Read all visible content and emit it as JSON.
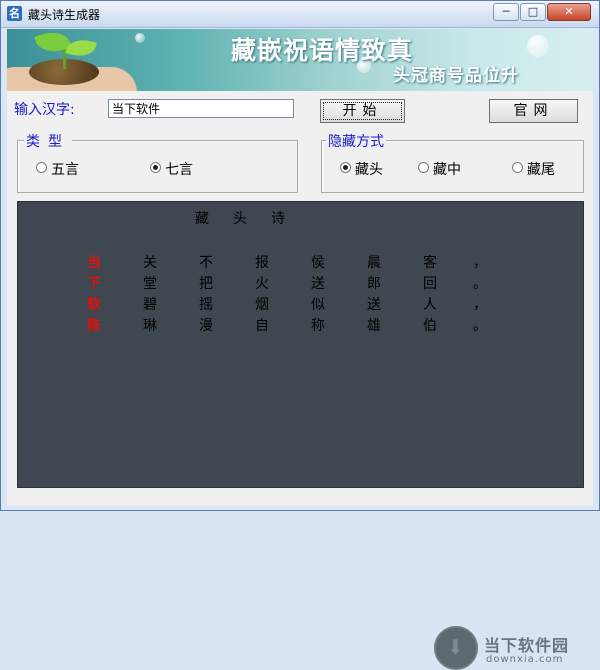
{
  "window": {
    "title": "藏头诗生成器",
    "app_icon_glyph": "名",
    "minimize_glyph": "─",
    "maximize_glyph": "□",
    "close_glyph": "✕"
  },
  "banner": {
    "main": "藏嵌祝语情致真",
    "sub": "头冠商号品位升"
  },
  "input": {
    "label": "输入汉字:",
    "value": "当下软件"
  },
  "buttons": {
    "start": "开始",
    "official_site": "官网"
  },
  "type_group": {
    "title": "类型",
    "options": [
      "五言",
      "七言"
    ],
    "selected_index": 1
  },
  "hide_group": {
    "title": "隐藏方式",
    "options": [
      "藏头",
      "藏中",
      "藏尾"
    ],
    "selected_index": 0
  },
  "poem": {
    "title": "藏头诗",
    "lines": [
      [
        "当",
        "关",
        "不",
        "报",
        "侯",
        "晨",
        "客",
        "，"
      ],
      [
        "下",
        "堂",
        "把",
        "火",
        "送",
        "郎",
        "回",
        "。"
      ],
      [
        "软",
        "碧",
        "摇",
        "烟",
        "似",
        "送",
        "人",
        "，"
      ],
      [
        "陈",
        "琳",
        "漫",
        "自",
        "称",
        "雄",
        "伯",
        "。"
      ]
    ]
  },
  "watermark": {
    "text": "当下软件园",
    "url": "downxia.com"
  }
}
